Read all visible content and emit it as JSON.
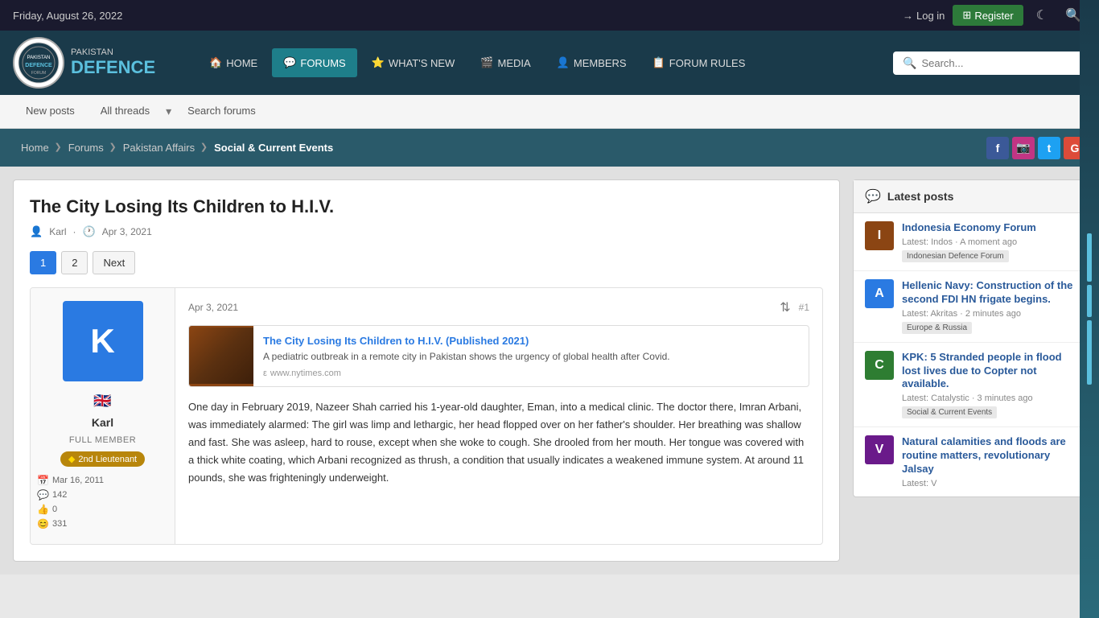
{
  "topbar": {
    "date": "Friday, August 26, 2022",
    "login_label": "Log in",
    "register_label": "Register"
  },
  "header": {
    "logo_small": "PAKISTAN",
    "logo_big": "DEFENCE",
    "nav": [
      {
        "label": "HOME",
        "icon": "🏠",
        "active": false
      },
      {
        "label": "FORUMS",
        "icon": "💬",
        "active": true
      },
      {
        "label": "WHAT'S NEW",
        "icon": "⭐",
        "active": false
      },
      {
        "label": "MEDIA",
        "icon": "🎬",
        "active": false
      },
      {
        "label": "MEMBERS",
        "icon": "👤",
        "active": false
      },
      {
        "label": "FORUM RULES",
        "icon": "📋",
        "active": false
      }
    ],
    "search_placeholder": "Search..."
  },
  "subnav": {
    "new_posts": "New posts",
    "all_threads": "All threads",
    "search_forums": "Search forums"
  },
  "breadcrumb": {
    "items": [
      {
        "label": "Home",
        "current": false
      },
      {
        "label": "Forums",
        "current": false
      },
      {
        "label": "Pakistan Affairs",
        "current": false
      },
      {
        "label": "Social & Current Events",
        "current": true
      }
    ]
  },
  "thread": {
    "title": "The City Losing Its Children to H.I.V.",
    "author": "Karl",
    "date": "Apr 3, 2021",
    "page_current": "1",
    "page_2": "2",
    "next_label": "Next"
  },
  "post": {
    "date": "Apr 3, 2021",
    "number": "#1",
    "author": {
      "initial": "K",
      "name": "Karl",
      "role": "FULL MEMBER",
      "rank": "2nd Lieutenant",
      "joined": "Mar 16, 2011",
      "messages": "142",
      "likes": "0",
      "reactions": "331"
    },
    "link_preview": {
      "title": "The City Losing Its Children to H.I.V. (Published 2021)",
      "description": "A pediatric outbreak in a remote city in Pakistan shows the urgency of global health after Covid.",
      "source": "www.nytimes.com"
    },
    "text": "One day in February 2019, Nazeer Shah carried his 1-year-old daughter, Eman, into a medical clinic. The doctor there, Imran Arbani, was immediately alarmed: The girl was limp and lethargic, her head flopped over on her father's shoulder. Her breathing was shallow and fast. She was asleep, hard to rouse, except when she woke to cough. She drooled from her mouth. Her tongue was covered with a thick white coating, which Arbani recognized as thrush, a condition that usually indicates a weakened immune system. At around 11 pounds, she was frighteningly underweight."
  },
  "sidebar": {
    "header": "Latest posts",
    "items": [
      {
        "title": "Indonesia Economy Forum",
        "meta": "Latest: Indos · A moment ago",
        "tag": "Indonesian Defence Forum",
        "avatar_color": "#8b4513",
        "avatar_text": "I"
      },
      {
        "title": "Hellenic Navy: Construction of the second FDI HN frigate begins.",
        "meta": "Latest: Akritas · 2 minutes ago",
        "tag": "Europe & Russia",
        "avatar_color": "#2a7ae2",
        "avatar_text": "A"
      },
      {
        "title": "KPK: 5 Stranded people in flood lost lives due to Copter not available.",
        "meta": "Latest: Catalystic · 3 minutes ago",
        "tag": "Social & Current Events",
        "avatar_color": "#2e7d32",
        "avatar_text": "C"
      },
      {
        "title": "Natural calamities and floods are routine matters, revolutionary Jalsay",
        "meta": "Latest: V",
        "tag": "",
        "avatar_color": "#6a1a8a",
        "avatar_text": "V"
      }
    ]
  }
}
